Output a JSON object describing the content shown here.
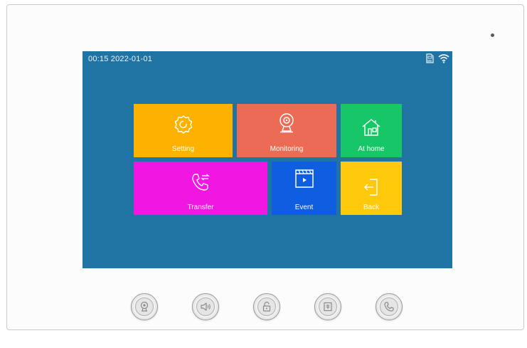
{
  "status_bar": {
    "datetime": "00:15 2022-01-01",
    "icons": [
      "sd-card-icon",
      "wifi-icon"
    ]
  },
  "tiles": [
    {
      "id": "setting",
      "label": "Setting",
      "icon": "gear-icon",
      "color": "#fdb200"
    },
    {
      "id": "monitoring",
      "label": "Monitoring",
      "icon": "webcam-icon",
      "color": "#ec6b55"
    },
    {
      "id": "at-home",
      "label": "At home",
      "icon": "house-icon",
      "color": "#17c667"
    },
    {
      "id": "transfer",
      "label": "Transfer",
      "icon": "phone-transfer-icon",
      "color": "#f117e3"
    },
    {
      "id": "event",
      "label": "Event",
      "icon": "clapperboard-icon",
      "color": "#0f5de0"
    },
    {
      "id": "back",
      "label": "Back",
      "icon": "exit-door-icon",
      "color": "#fec80b"
    }
  ],
  "hardware_buttons": [
    {
      "id": "monitor",
      "icon": "webcam-icon"
    },
    {
      "id": "talk",
      "icon": "speaker-icon"
    },
    {
      "id": "unlock",
      "icon": "unlock-icon"
    },
    {
      "id": "menu",
      "icon": "menu-icon"
    },
    {
      "id": "call",
      "icon": "phone-icon"
    }
  ],
  "colors": {
    "screen_background": "#1f74a4",
    "device_body": "#fcfcfc"
  }
}
